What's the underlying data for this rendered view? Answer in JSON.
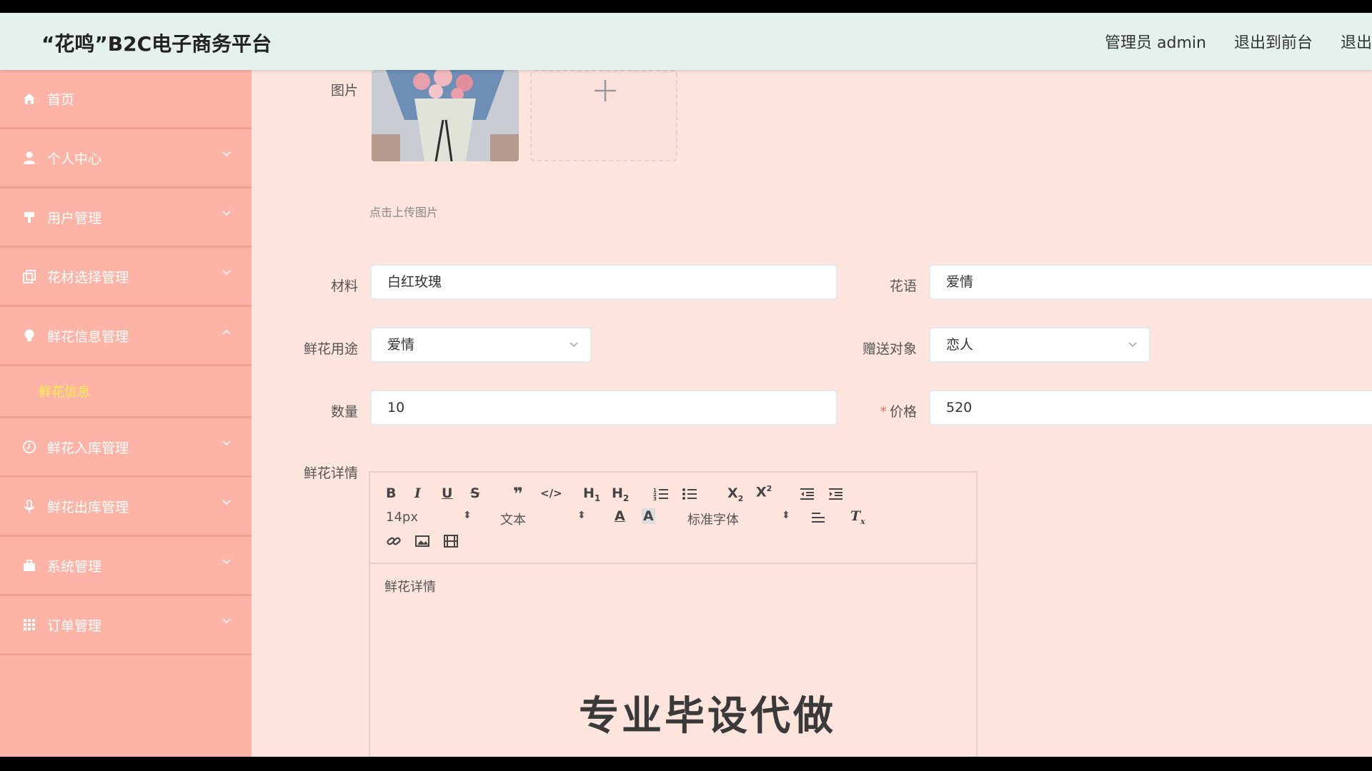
{
  "header": {
    "brand": "“花鸣”B2C电子商务平台",
    "user": "管理员 admin",
    "to_front": "退出到前台",
    "logout": "退出"
  },
  "sidebar": {
    "items": [
      {
        "label": "首页",
        "icon": "home-icon"
      },
      {
        "label": "个人中心",
        "icon": "user-icon"
      },
      {
        "label": "用户管理",
        "icon": "user-manage-icon"
      },
      {
        "label": "花材选择管理",
        "icon": "copy-icon"
      },
      {
        "label": "鲜花信息管理",
        "icon": "bulb-icon",
        "expanded": true
      },
      {
        "label": "鲜花入库管理",
        "icon": "clock-icon"
      },
      {
        "label": "鲜花出库管理",
        "icon": "mic-icon"
      },
      {
        "label": "系统管理",
        "icon": "briefcase-icon"
      },
      {
        "label": "订单管理",
        "icon": "grid-icon"
      }
    ],
    "sub_active": "鲜花信息"
  },
  "form": {
    "image_label": "图片",
    "upload_hint": "点击上传图片",
    "material_label": "材料",
    "material_value": "白红玫瑰",
    "flower_lang_label": "花语",
    "flower_lang_value": "爱情",
    "usage_label": "鲜花用途",
    "usage_value": "爱情",
    "target_label": "赠送对象",
    "target_value": "恋人",
    "qty_label": "数量",
    "qty_value": "10",
    "price_label": "价格",
    "price_required": "*",
    "price_value": "520",
    "detail_label": "鲜花详情"
  },
  "editor": {
    "font_size": "14px",
    "text_type": "文本",
    "font_family": "标准字体",
    "content": "鲜花详情"
  },
  "watermark": "专业毕设代做",
  "colors": {
    "header_bg": "#e5f1ec",
    "sidebar_bg": "#fdb4a6",
    "content_bg": "#fde4dd",
    "active_sub": "#fff24a",
    "required": "#f56c6c"
  }
}
